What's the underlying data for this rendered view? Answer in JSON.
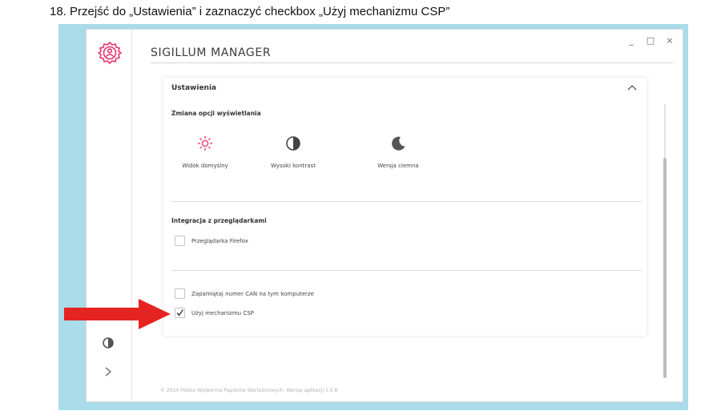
{
  "caption": "18. Przejść do „Ustawienia” i zaznaczyć checkbox „Użyj mechanizmu CSP”",
  "window": {
    "title": "SIGILLUM MANAGER",
    "controls": {
      "minimize": "_",
      "maximize": "□",
      "close": "×"
    }
  },
  "settings": {
    "title": "Ustawienia",
    "display_section": {
      "title": "Zmiana opcji wyświetlania",
      "options": [
        {
          "label": "Widok domyślny",
          "icon": "sun-icon",
          "color": "#e8336d"
        },
        {
          "label": "Wysoki kontrast",
          "icon": "contrast-icon",
          "color": "#444444"
        },
        {
          "label": "Wersja ciemna",
          "icon": "moon-icon",
          "color": "#444444"
        }
      ]
    },
    "browser_section": {
      "title": "Integracja z przeglądarkami",
      "firefox": {
        "label": "Przeglądarka Firefox",
        "checked": false
      }
    },
    "other": {
      "remember_can": {
        "label": "Zapamiętaj numer CAN na tym komputerze",
        "checked": false
      },
      "use_csp": {
        "label": "Użyj mechanizmu CSP",
        "checked": true
      }
    }
  },
  "footer": "© 2024 Polska Wytwórnia Papierów Wartościowych. Wersja aplikacji 1.0.8",
  "colors": {
    "accent": "#e8336d",
    "frame": "#a9dbe9",
    "arrow": "#e52421"
  }
}
